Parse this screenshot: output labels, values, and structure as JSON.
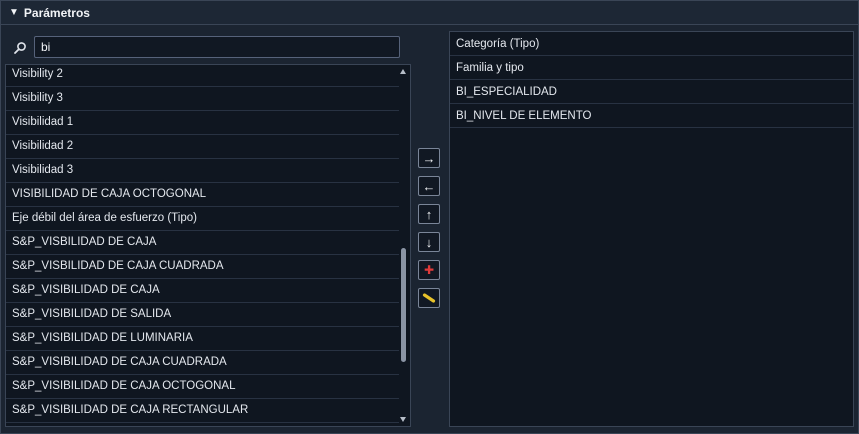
{
  "header": {
    "title": "Parámetros",
    "toggle_icon": "triangle-down-icon"
  },
  "search": {
    "value": "bi",
    "icon": "search-icon"
  },
  "left_list": {
    "items": [
      "Visibility 2",
      "Visibility 3",
      "Visibilidad 1",
      "Visibilidad 2",
      "Visibilidad 3",
      "VISIBILIDAD DE CAJA OCTOGONAL",
      "Eje débil del área de esfuerzo (Tipo)",
      "S&P_VISBILIDAD DE CAJA",
      "S&P_VISBILIDAD DE CAJA CUADRADA",
      "S&P_VISIBILIDAD DE CAJA",
      "S&P_VISIBILIDAD DE SALIDA",
      "S&P_VISIBILIDAD DE LUMINARIA",
      "S&P_VISIBILIDAD DE CAJA CUADRADA",
      "S&P_VISIBILIDAD DE CAJA OCTOGONAL",
      "S&P_VISIBILIDAD DE CAJA RECTANGULAR"
    ]
  },
  "buttons": {
    "add_right": "→",
    "remove_left": "←",
    "move_up": "↑",
    "move_down": "↓",
    "add_param": "✚",
    "edit_param": "pencil-icon"
  },
  "colors": {
    "add_icon": "#e03a3a",
    "edit_icon": "#e8c22a"
  },
  "right_list": {
    "items": [
      "Categoría (Tipo)",
      "Familia y tipo",
      "BI_ESPECIALIDAD",
      "BI_NIVEL DE ELEMENTO"
    ]
  }
}
